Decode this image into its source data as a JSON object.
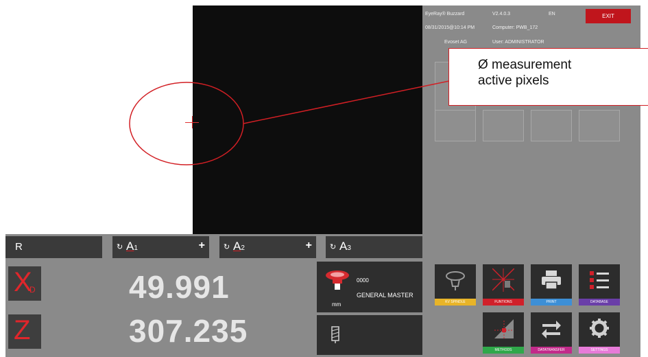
{
  "header": {
    "app_name": "EyeRay® Buzzard",
    "version": "V2.4.0.3",
    "language": "EN",
    "datetime": "08/31/2015@10:14 PM",
    "computer": "Computer: PWB_172",
    "company": "Evoset AG",
    "user": "User: ADMINISTRATOR",
    "exit_label": "EXIT"
  },
  "tabs": {
    "r_label": "R",
    "a1": {
      "rot": "↻",
      "name": "A",
      "sub": "1",
      "plus": "+"
    },
    "a2": {
      "rot": "↻",
      "name": "A",
      "sub": "2",
      "plus": "+"
    },
    "a3": {
      "rot": "↻",
      "name": "A",
      "sub": "3"
    }
  },
  "dro": {
    "x_letter": "X",
    "x_sub": "D",
    "x_value": "49.991",
    "z_letter": "Z",
    "z_value": "307.235"
  },
  "tool": {
    "code": "0000",
    "name": "GENERAL MASTER",
    "unit": "mm"
  },
  "functions": [
    {
      "label": "KV SPINDLE",
      "color": "#e8b428",
      "icon": "spindle-icon"
    },
    {
      "label": "FUNTIONS",
      "color": "#d0202a",
      "icon": "crosshair-function-icon"
    },
    {
      "label": "PRINT",
      "color": "#3d8fd6",
      "icon": "printer-icon"
    },
    {
      "label": "DATABASE",
      "color": "#6a3ea8",
      "icon": "checklist-icon"
    },
    {
      "label": "METHODS",
      "color": "#2fa84a",
      "icon": "methods-icon"
    },
    {
      "label": "DATATRANSFER",
      "color": "#c22a8a",
      "icon": "transfer-arrows-icon"
    },
    {
      "label": "SETTINGS",
      "color": "#e77bd8",
      "icon": "gear-icon"
    }
  ],
  "annotation": {
    "line1": "Ø measurement",
    "line2": "active pixels",
    "color": "#d21f24"
  }
}
